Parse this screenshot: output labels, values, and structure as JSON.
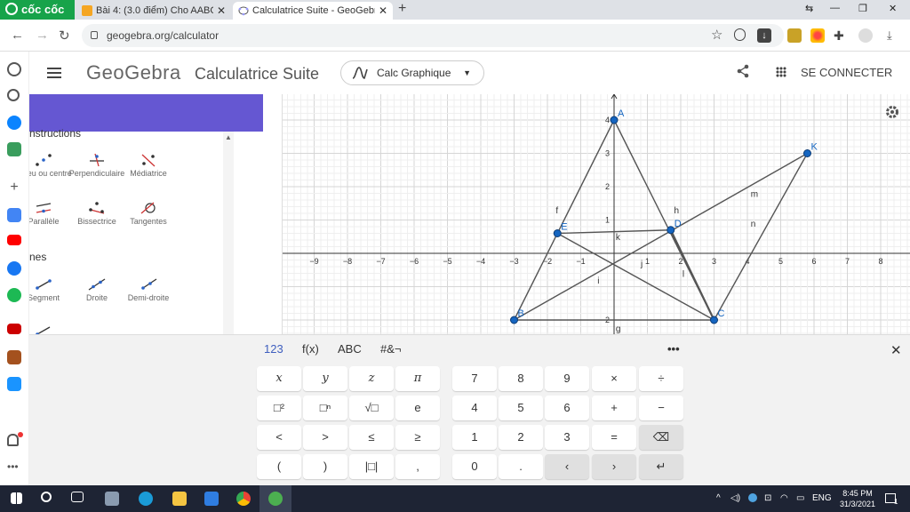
{
  "browser": {
    "brand": "cốc cốc",
    "tabs": [
      {
        "title": "Bài 4: (3.0 điểm) Cho AABC cả",
        "active": false
      },
      {
        "title": "Calculatrice Suite - GeoGebra",
        "active": true
      }
    ],
    "url": "geogebra.org/calculator"
  },
  "app": {
    "logo": "GeoGebra",
    "title": "Calculatrice Suite",
    "calc_selector": "Calc Graphique",
    "sign_in": "SE CONNECTER"
  },
  "tools": {
    "section_constructions": "nstructions",
    "section_lines": "nes",
    "construction_tools": [
      {
        "label": "Milieu ou centre",
        "icon": "midpoint-icon"
      },
      {
        "label": "Perpendiculaire",
        "icon": "perpendicular-icon"
      },
      {
        "label": "Médiatrice",
        "icon": "perpendicular-bisector-icon"
      },
      {
        "label": "Parallèle",
        "icon": "parallel-icon"
      },
      {
        "label": "Bissectrice",
        "icon": "angle-bisector-icon"
      },
      {
        "label": "Tangentes",
        "icon": "tangents-icon"
      }
    ],
    "line_tools": [
      {
        "label": "Segment",
        "icon": "segment-icon"
      },
      {
        "label": "Droite",
        "icon": "line-icon"
      },
      {
        "label": "Demi-droite",
        "icon": "ray-icon"
      }
    ]
  },
  "graph": {
    "x_range": [
      -9.5,
      9
    ],
    "y_range": [
      -2.4,
      4.8
    ],
    "x_ticks": [
      -9,
      -8,
      -7,
      -6,
      -5,
      -4,
      -3,
      -2,
      -1,
      1,
      2,
      3,
      4,
      5,
      6,
      7,
      8
    ],
    "y_ticks": [
      -2,
      1,
      2,
      3,
      4
    ],
    "points": [
      {
        "name": "A",
        "x": 0,
        "y": 4
      },
      {
        "name": "B",
        "x": -3,
        "y": -2
      },
      {
        "name": "C",
        "x": 3,
        "y": -2
      },
      {
        "name": "D",
        "x": 1.7,
        "y": 0.7
      },
      {
        "name": "E",
        "x": -1.7,
        "y": 0.6
      },
      {
        "name": "K",
        "x": 5.8,
        "y": 3
      }
    ],
    "segments": [
      [
        "A",
        "B"
      ],
      [
        "A",
        "C"
      ],
      [
        "B",
        "C"
      ],
      [
        "E",
        "D"
      ],
      [
        "B",
        "K"
      ],
      [
        "K",
        "C"
      ],
      [
        "E",
        "C"
      ],
      [
        "D",
        "C"
      ]
    ],
    "labels": [
      {
        "text": "f",
        "x": -1.75,
        "y": 1.2
      },
      {
        "text": "h",
        "x": 1.8,
        "y": 1.2
      },
      {
        "text": "k",
        "x": 0.05,
        "y": 0.4
      },
      {
        "text": "j",
        "x": 0.8,
        "y": -0.4
      },
      {
        "text": "i",
        "x": -0.5,
        "y": -0.9
      },
      {
        "text": "l",
        "x": 2.05,
        "y": -0.7
      },
      {
        "text": "m",
        "x": 4.1,
        "y": 1.7
      },
      {
        "text": "n",
        "x": 4.1,
        "y": 0.8
      },
      {
        "text": "g",
        "x": 0.05,
        "y": -2.35
      }
    ],
    "colors": {
      "point": "#1565c0",
      "segment": "#555555",
      "label_point": "#1565c0"
    }
  },
  "keyboard": {
    "tabs": [
      "123",
      "f(x)",
      "ABC",
      "#&¬"
    ],
    "more": "•••",
    "close": "✕",
    "left_keys": [
      [
        "x",
        "y",
        "z",
        "π"
      ],
      [
        "□²",
        "□ⁿ",
        "√□",
        "e"
      ],
      [
        "<",
        ">",
        "≤",
        "≥"
      ],
      [
        "(",
        ")",
        "|□|",
        ","
      ]
    ],
    "right_keys": [
      [
        "7",
        "8",
        "9",
        "×",
        "÷"
      ],
      [
        "4",
        "5",
        "6",
        "+",
        "−"
      ],
      [
        "1",
        "2",
        "3",
        "=",
        "⌫"
      ],
      [
        "0",
        ".",
        "‹",
        "›",
        "↵"
      ]
    ]
  },
  "taskbar": {
    "lang": "ENG",
    "time": "8:45 PM",
    "date": "31/3/2021",
    "notif_count": "1"
  }
}
